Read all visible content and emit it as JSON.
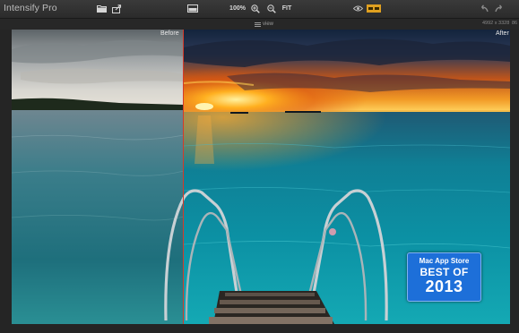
{
  "app": {
    "title": "Intensify Pro"
  },
  "toolbar": {
    "zoom_percent": "100%",
    "fit_label": "FIT",
    "icons": [
      "folder-icon",
      "share-icon",
      "compare-icon",
      "zoom-in-icon",
      "zoom-out-icon",
      "eye-icon",
      "split-view-icon",
      "undo-icon",
      "redo-icon"
    ]
  },
  "infobar": {
    "view_label": "view",
    "image_size": "4992 x 3328",
    "zoom_value": "86"
  },
  "canvas": {
    "before_label": "Before",
    "after_label": "After"
  },
  "badge": {
    "line1": "Mac App Store",
    "line2": "BEST OF",
    "line3": "2013",
    "color": "#1d6fd9"
  },
  "colors": {
    "split_line": "#d43a2a",
    "toolbar_bg": "#2e2e2e",
    "active_toggle": "#e0a020"
  }
}
